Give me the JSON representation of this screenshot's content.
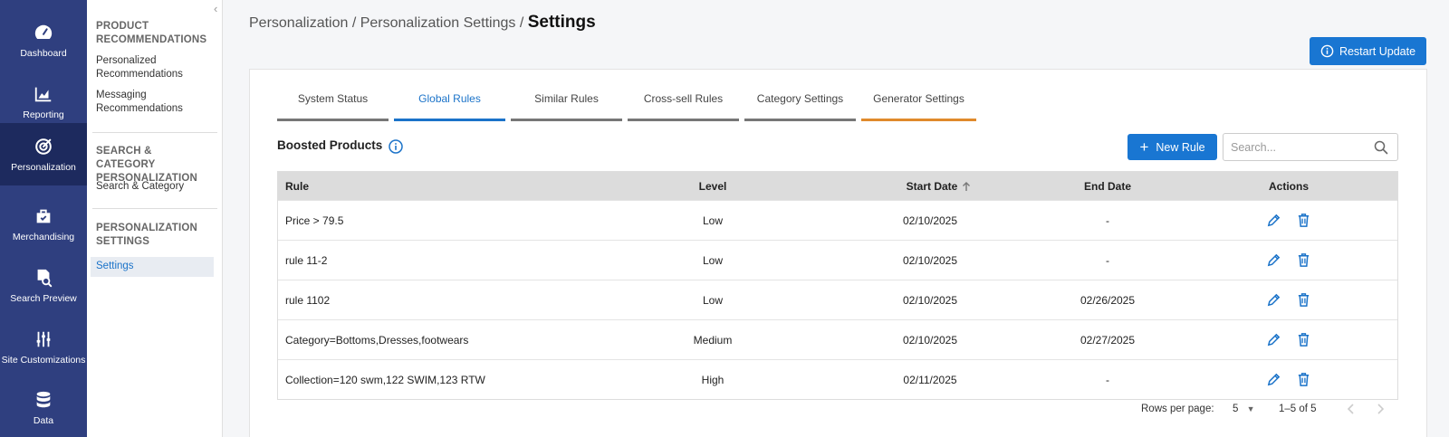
{
  "rail": {
    "items": [
      {
        "label": "Dashboard",
        "icon": "gauge-icon"
      },
      {
        "label": "Reporting",
        "icon": "chart-icon"
      },
      {
        "label": "Personalization",
        "icon": "target-icon"
      },
      {
        "label": "Merchandising",
        "icon": "bag-icon"
      },
      {
        "label": "Search Preview",
        "icon": "doc-search-icon"
      },
      {
        "label": "Site Customizations",
        "icon": "sliders-icon"
      },
      {
        "label": "Data",
        "icon": "database-icon"
      }
    ]
  },
  "sidebar": {
    "groups": [
      {
        "heading": "PRODUCT RECOMMENDATIONS",
        "links": [
          "Personalized Recommendations",
          "Messaging Recommendations"
        ]
      },
      {
        "heading": "SEARCH & CATEGORY PERSONALIZATION",
        "links": [
          "Search & Category"
        ]
      },
      {
        "heading": "PERSONALIZATION SETTINGS",
        "links": [
          "Settings"
        ]
      }
    ]
  },
  "header": {
    "breadcrumb_trail": "Personalization / Personalization Settings /",
    "breadcrumb_current": "Settings",
    "restart_label": "Restart Update"
  },
  "tabs": [
    "System Status",
    "Global Rules",
    "Similar Rules",
    "Cross-sell Rules",
    "Category Settings",
    "Generator Settings"
  ],
  "section": {
    "title": "Boosted Products",
    "new_rule_label": "New Rule",
    "search_placeholder": "Search..."
  },
  "table": {
    "headers": {
      "rule": "Rule",
      "level": "Level",
      "start": "Start Date",
      "end": "End Date",
      "actions": "Actions"
    },
    "rows": [
      {
        "rule": "Price > 79.5",
        "level": "Low",
        "start": "02/10/2025",
        "end": "-"
      },
      {
        "rule": "rule 11-2",
        "level": "Low",
        "start": "02/10/2025",
        "end": "-"
      },
      {
        "rule": "rule 1102",
        "level": "Low",
        "start": "02/10/2025",
        "end": "02/26/2025"
      },
      {
        "rule": "Category=Bottoms,Dresses,footwears",
        "level": "Medium",
        "start": "02/10/2025",
        "end": "02/27/2025"
      },
      {
        "rule": "Collection=120 swm,122 SWIM,123 RTW",
        "level": "High",
        "start": "02/11/2025",
        "end": "-"
      }
    ]
  },
  "pagination": {
    "rows_label": "Rows per page:",
    "rows_value": "5",
    "range": "1–5 of 5"
  },
  "colors": {
    "rail": "#2f3f7f",
    "rail_active": "#1d2a5e",
    "accent": "#1976d2",
    "tab_generator": "#e08a2c"
  }
}
